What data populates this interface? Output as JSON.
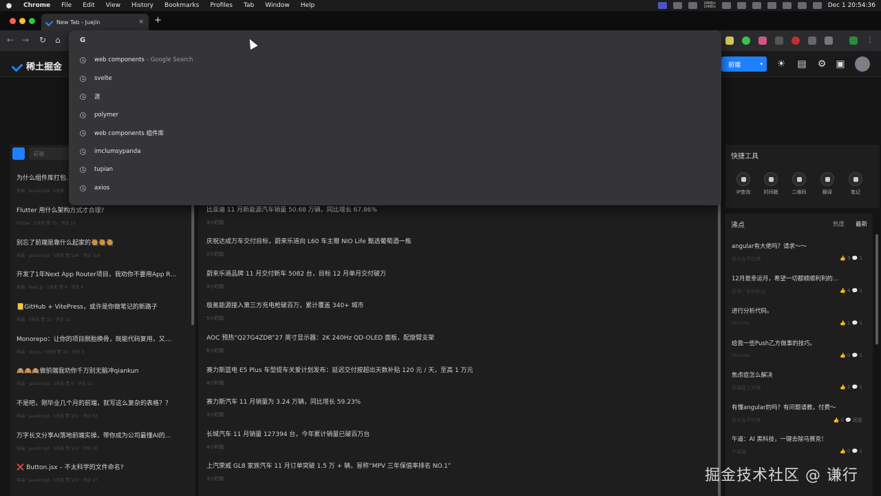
{
  "menubar": {
    "app": "Chrome",
    "items": [
      "File",
      "Edit",
      "View",
      "History",
      "Bookmarks",
      "Profiles",
      "Tab",
      "Window",
      "Help"
    ],
    "net_up": "24KB/s",
    "net_down": "10KB/s",
    "clock": "Dec 1  20:54:36"
  },
  "tab": {
    "title": "New Tab - Juejin",
    "close": "×",
    "new": "+"
  },
  "omnibox": {
    "icon": "G",
    "suggestions": [
      {
        "text": "web components",
        "extra": "- Google Search"
      },
      {
        "text": "svelte",
        "extra": ""
      },
      {
        "text": "涯",
        "extra": ""
      },
      {
        "text": "polymer",
        "extra": ""
      },
      {
        "text": "web components 组件库",
        "extra": ""
      },
      {
        "text": "imclumsypanda",
        "extra": ""
      },
      {
        "text": "tupian",
        "extra": ""
      },
      {
        "text": "axios",
        "extra": ""
      }
    ]
  },
  "header": {
    "logo": "稀土掘金",
    "category_button": "前端",
    "caret": "▾"
  },
  "left": {
    "select": "前端",
    "items": [
      {
        "title": "为什么组件库打包…",
        "meta": "前端 · JavaScript · 5天前"
      },
      {
        "title": "Flutter 用什么架构方式才合理?",
        "meta": "Flutter · 5天前      赞 75 · 评论 25"
      },
      {
        "title": "别忘了前端是靠什么起家的🥘🥘🥘",
        "meta": "前端 · JavaScript · 5天前      赞 194 · 评论 104"
      },
      {
        "title": "开发了1年Next App Router项目，我劝你不要用App R…",
        "meta": "前端 · Next.js · 5天前      赞 4 · 评论 4"
      },
      {
        "title": "📒GitHub + VitePress，或许是你做笔记的新路子",
        "meta": "前端 · 5天前      赞 31 · 评论 15"
      },
      {
        "title": "Monorepo：让你的项目脱胎换骨，既能代码复用，又…",
        "meta": "前端 · Vue.js · 5天前      赞 45 · 评论 3"
      },
      {
        "title": "🙈🙈🙈做前端我劝你千万别无脑冲qiankun",
        "meta": "前端 · JavaScript · 2天前      赞 6 · 评论 11"
      },
      {
        "title": "不是吧，刚毕业几个月的前端，就写这么复杂的表格？？",
        "meta": "前端 · JavaScript · 5天前      赞 201 · 评论 63"
      },
      {
        "title": "万字长文分享AI落地前端实操，带你成为公司最懂AI的…",
        "meta": "前端 · JavaScript · 5天前      赞 103 · 评论 30"
      },
      {
        "title": "❌ Button.jsx – 不太科学的文件命名?",
        "meta": "前端 · JavaScript · 5天前      赞 103 · 评论 27"
      }
    ]
  },
  "middle": {
    "items": [
      {
        "title": "比亚迪 11 月新能源汽车销量 50.68 万辆，同比增长 67.86%",
        "time": "3小时前"
      },
      {
        "title": "庆祝达成万车交付目标，蔚来乐道向 L60 车主赠 NIO Life 甄选葡萄酒一瓶",
        "time": "2小时前"
      },
      {
        "title": "蔚来乐道品牌 11 月交付新车 5082 台，目标 12 月单月交付破万",
        "time": "4小时前"
      },
      {
        "title": "极氪能源接入第三方充电枪破百万，累计覆盖 340+ 城市",
        "time": "5小时前"
      },
      {
        "title": "AOC 预热“Q27G4ZDB”27 英寸显示器：2K 240Hz QD-OLED 面板，配旋臂支架",
        "time": "6小时前"
      },
      {
        "title": "赛力斯蓝电 E5 Plus 车型提车关爱计划发布：延迟交付按超出天数补贴 120 元 / 天，至高 1 万元",
        "time": "4小时前"
      },
      {
        "title": "赛力斯汽车 11 月销量为 3.24 万辆，同比增长 59.23%",
        "time": "3小时前"
      },
      {
        "title": "长城汽车 11 月销量 127394 台，今年累计销量已破百万台",
        "time": "4小时前"
      },
      {
        "title": "上汽荣威 GL8 家族汽车 11 月订单突破 1.5 万 + 辆，冒称“MPV 三年保值率排名 NO.1”",
        "time": "3小时前"
      }
    ]
  },
  "tools": {
    "title": "快捷工具",
    "items": [
      "IP查询",
      "时间戳",
      "二维码",
      "翻译",
      "笔记"
    ]
  },
  "hot": {
    "title": "沸点",
    "tab_hot": "热度",
    "tab_new": "最新",
    "items": [
      {
        "title": "angular有大佬吗？请求～～",
        "author": "前大仙不吃辣",
        "stats": "👍 3   💬 1"
      },
      {
        "title": "12月是幸运月，希望一切都顺顺利利的…",
        "author": "前端一名的Bug",
        "stats": "👍 4   💬 1"
      },
      {
        "title": "进行分析代码。",
        "author": "Starlaw",
        "stats": "👍 1   💬 1"
      },
      {
        "title": "给我一些Push乙方做事的技巧。",
        "author": "Starlaw",
        "stats": "👍 0   💬 1"
      },
      {
        "title": "焦虑症怎么解决",
        "author": "前端路上大神",
        "stats": "👍 2   💬 1"
      },
      {
        "title": "有懂angular的吗？有问题请教，付费～",
        "author": "前大仙不吃辣",
        "stats": "👍 0   💬 回复"
      },
      {
        "title": "午逼：AI 黑科技，一键去除马赛克！",
        "author": "午逼逼",
        "stats": "👍 0   💬 1"
      }
    ]
  },
  "watermark": "掘金技术社区 @ 谦行"
}
